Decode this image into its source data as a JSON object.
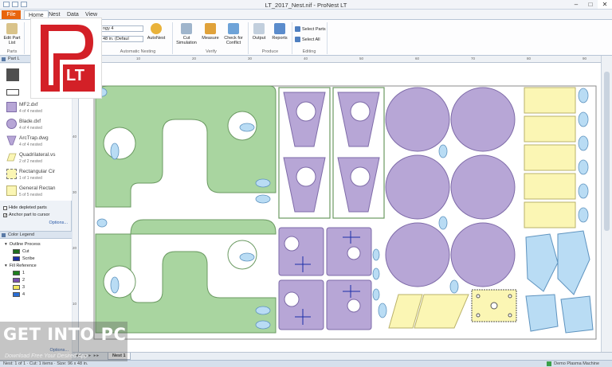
{
  "window": {
    "title": "LT_2017_Nest.nif - ProNest LT",
    "minimize": "–",
    "maximize": "□",
    "close": "✕"
  },
  "menu": {
    "file": "File",
    "home": "Home",
    "nest": "Nest",
    "data": "Data",
    "view": "View"
  },
  "ribbon": {
    "edit_part_list": "Edit Part List",
    "parts_group": "Parts",
    "nest_combo": "ngy 4",
    "sheet_combo": "48 in. (Defaul",
    "autonest": "AutoNest",
    "automatic_nesting_group": "Automatic Nesting",
    "cut_simulation": "Cut Simulation",
    "measure": "Measure",
    "check_for_conflict": "Check for Conflict",
    "verify_group": "Verify",
    "output": "Output",
    "reports": "Reports",
    "produce_group": "Produce",
    "select_parts": "Select Parts",
    "select_all": "Select All",
    "editing_group": "Editing"
  },
  "part_list": {
    "header": "Part L",
    "items": [
      {
        "name": "MF2.dxf",
        "count": "4 of 4 nested"
      },
      {
        "name": "Blade.dxf",
        "count": "4 of 4 nested"
      },
      {
        "name": "ArcTrap.dwg",
        "count": "4 of 4 nested"
      },
      {
        "name": "Quadrilateral.vs",
        "count": "2 of 2 nested"
      },
      {
        "name": "Rectangular Cir",
        "count": "1 of 1 nested"
      },
      {
        "name": "General Rectan",
        "count": "5 of 5 nested"
      }
    ],
    "hide_depleted": "Hide depleted parts",
    "anchor_part": "Anchor part to cursor",
    "options": "Options..."
  },
  "color_legend": {
    "header": "Color Legend",
    "outline_process": "Outline Process",
    "cut": "Cut",
    "scribe": "Scribe",
    "fill_reference": "Fill Reference",
    "fills": [
      "1",
      "2",
      "3",
      "4"
    ],
    "options": "Options...",
    "colors": {
      "cut": "#1f6e1f",
      "scribe": "#1b2fa8",
      "fill1": "#1d7f1d",
      "fill2": "#7a4fb0",
      "fill3": "#f2e75a",
      "fill4": "#2a6fd6"
    }
  },
  "sheet_tabs": {
    "nav": "◂◂ ◂ ▸ ▸▸",
    "active": "Nest 1"
  },
  "status": {
    "left": "Nest: 1 of 1 · Cut: 1 items · Size: 96 x 48 in.",
    "machine": "Demo Plasma Machine"
  },
  "watermark": {
    "big": "GET INTO PC",
    "small": "Download Free Your Desired App"
  },
  "logo": {
    "text": "LT"
  },
  "rulers": {
    "top": [
      "0",
      "10",
      "20",
      "30",
      "40",
      "50",
      "60",
      "70",
      "80",
      "90"
    ],
    "left": [
      "50",
      "40",
      "30",
      "20",
      "10"
    ]
  },
  "parts_colors": {
    "green": "#a9d5a0",
    "green_stroke": "#6b9a62",
    "purple": "#b7a6d6",
    "purple_stroke": "#7e6ba8",
    "blue": "#b9dcf4",
    "blue_stroke": "#5e93bf",
    "yellow": "#fbf6b4",
    "yellow_stroke": "#bab26a",
    "sheet_stroke": "#8b8b8b"
  }
}
